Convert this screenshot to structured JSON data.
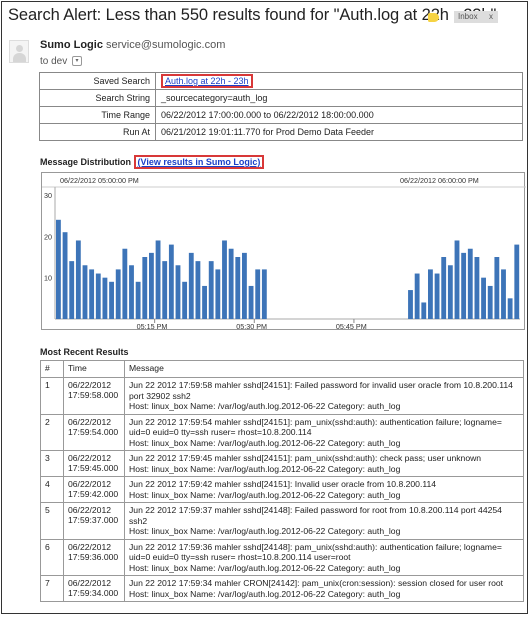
{
  "email": {
    "subject": "Search Alert: Less than 550 results found for \"Auth.log at 22h - 23h\"",
    "inbox_label": "Inbox",
    "inbox_close": "x",
    "sender_name": "Sumo Logic",
    "sender_email": "service@sumologic.com",
    "to_line": "to dev",
    "to_dropdown_glyph": "▾"
  },
  "info_table": {
    "rows": [
      {
        "key": "Saved Search",
        "value": "Auth.log at 22h - 23h",
        "is_link": true
      },
      {
        "key": "Search String",
        "value": "_sourcecategory=auth_log"
      },
      {
        "key": "Time Range",
        "value": "06/22/2012 17:00:00.000 to 06/22/2012 18:00:00.000"
      },
      {
        "key": "Run At",
        "value": "06/21/2012 19:01:11.770 for Prod Demo Data Feeder"
      }
    ]
  },
  "distribution": {
    "title": "Message Distribution",
    "link_text": "(View results in Sumo Logic)"
  },
  "chart_data": {
    "type": "bar",
    "top_left_label": "06/22/2012 05:00:00 PM",
    "top_right_label": "06/22/2012 06:00:00 PM",
    "ylim": [
      0,
      30
    ],
    "yticks": [
      "30",
      "20",
      "10"
    ],
    "x_ticks": [
      {
        "label": "05:15 PM",
        "minute": 15
      },
      {
        "label": "05:30 PM",
        "minute": 30
      },
      {
        "label": "05:45 PM",
        "minute": 45
      }
    ],
    "bar_color": "#3d74b8",
    "bars_start_minute": 0,
    "minutes_per_bar": 1,
    "values": [
      24,
      21,
      14,
      19,
      13,
      12,
      11,
      10,
      9,
      12,
      17,
      13,
      9,
      15,
      16,
      19,
      14,
      18,
      13,
      9,
      16,
      14,
      8,
      14,
      12,
      19,
      17,
      15,
      16,
      8,
      12,
      12,
      0,
      0,
      0,
      0,
      0,
      0,
      0,
      0,
      0,
      0,
      0,
      0,
      0,
      0,
      0,
      0,
      0,
      0,
      0,
      0,
      0,
      7,
      11,
      4,
      12,
      11,
      15,
      13,
      19,
      16,
      17,
      15,
      10,
      8,
      15,
      12,
      5,
      18
    ]
  },
  "results": {
    "title": "Most Recent Results",
    "columns": [
      "#",
      "Time",
      "Message"
    ],
    "rows": [
      {
        "n": "1",
        "date": "06/22/2012",
        "time": "17:59:58.000",
        "lines": [
          "Jun 22 2012 17:59:58 mahler sshd[24151]: Failed password for invalid user oracle from 10.8.200.114 port 32902 ssh2",
          "Host: linux_box   Name: /var/log/auth.log.2012-06-22   Category: auth_log"
        ]
      },
      {
        "n": "2",
        "date": "06/22/2012",
        "time": "17:59:54.000",
        "lines": [
          "Jun 22 2012 17:59:54 mahler sshd[24151]: pam_unix(sshd:auth): authentication failure; logname= uid=0 euid=0 tty=ssh ruser= rhost=10.8.200.114",
          "Host: linux_box   Name: /var/log/auth.log.2012-06-22   Category: auth_log"
        ]
      },
      {
        "n": "3",
        "date": "06/22/2012",
        "time": "17:59:45.000",
        "lines": [
          "Jun 22 2012 17:59:45 mahler sshd[24151]: pam_unix(sshd:auth): check pass; user unknown",
          "Host: linux_box   Name: /var/log/auth.log.2012-06-22   Category: auth_log"
        ]
      },
      {
        "n": "4",
        "date": "06/22/2012",
        "time": "17:59:42.000",
        "lines": [
          "Jun 22 2012 17:59:42 mahler sshd[24151]: Invalid user oracle from 10.8.200.114",
          "Host: linux_box   Name: /var/log/auth.log.2012-06-22   Category: auth_log"
        ]
      },
      {
        "n": "5",
        "date": "06/22/2012",
        "time": "17:59:37.000",
        "lines": [
          "Jun 22 2012 17:59:37 mahler sshd[24148]: Failed password for root from 10.8.200.114 port 44254 ssh2",
          "Host: linux_box   Name: /var/log/auth.log.2012-06-22   Category: auth_log"
        ]
      },
      {
        "n": "6",
        "date": "06/22/2012",
        "time": "17:59:36.000",
        "lines": [
          "Jun 22 2012 17:59:36 mahler sshd[24148]: pam_unix(sshd:auth): authentication failure; logname= uid=0 euid=0 tty=ssh ruser= rhost=10.8.200.114 user=root",
          "Host: linux_box   Name: /var/log/auth.log.2012-06-22   Category: auth_log"
        ]
      },
      {
        "n": "7",
        "date": "06/22/2012",
        "time": "17:59:34.000",
        "lines": [
          "Jun 22 2012 17:59:34 mahler CRON[24142]: pam_unix(cron:session): session closed for user root",
          "Host: linux_box   Name: /var/log/auth.log.2012-06-22   Category: auth_log"
        ]
      }
    ]
  }
}
